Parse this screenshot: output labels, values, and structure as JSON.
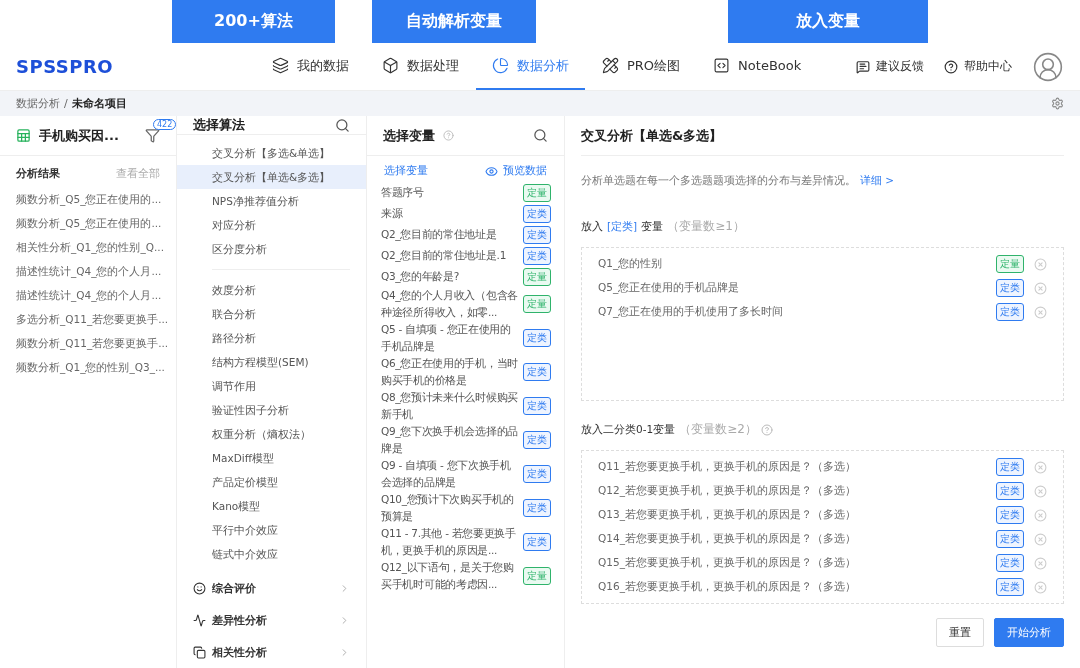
{
  "callouts": [
    "200+算法",
    "自动解析变量",
    "放入变量"
  ],
  "logo": "SPSSPRO",
  "nav": [
    {
      "label": "我的数据",
      "selected": false
    },
    {
      "label": "数据处理",
      "selected": false
    },
    {
      "label": "数据分析",
      "selected": true
    },
    {
      "label": "PRO绘图",
      "selected": false
    },
    {
      "label": "NoteBook",
      "selected": false
    }
  ],
  "nav_right": [
    "建议反馈",
    "帮助中心"
  ],
  "breadcrumb": {
    "items": [
      "数据分析",
      "未命名项目"
    ],
    "separator": "/"
  },
  "dataset": {
    "name": "手机购买因...",
    "count": "422"
  },
  "results": {
    "title": "分析结果",
    "view_all": "查看全部",
    "items": [
      "频数分析_Q5_您正在使用的...",
      "频数分析_Q5_您正在使用的...",
      "相关性分析_Q1_您的性别_Q...",
      "描述性统计_Q4_您的个人月...",
      "描述性统计_Q4_您的个人月...",
      "多选分析_Q11_若您要更换手...",
      "频数分析_Q11_若您要更换手...",
      "频数分析_Q1_您的性别_Q3_..."
    ]
  },
  "algorithms": {
    "title": "选择算法",
    "groups": [
      [
        {
          "label": "交叉分析【多选&单选】",
          "selected": false
        },
        {
          "label": "交叉分析【单选&多选】",
          "selected": true
        },
        {
          "label": "NPS净推荐值分析",
          "selected": false
        },
        {
          "label": "对应分析",
          "selected": false
        },
        {
          "label": "区分度分析",
          "selected": false
        }
      ],
      [
        {
          "label": "效度分析",
          "selected": false
        },
        {
          "label": "联合分析",
          "selected": false
        },
        {
          "label": "路径分析",
          "selected": false
        },
        {
          "label": "结构方程模型(SEM)",
          "selected": false
        },
        {
          "label": "调节作用",
          "selected": false
        },
        {
          "label": "验证性因子分析",
          "selected": false
        },
        {
          "label": "权重分析（熵权法）",
          "selected": false
        },
        {
          "label": "MaxDiff模型",
          "selected": false
        },
        {
          "label": "产品定价模型",
          "selected": false
        },
        {
          "label": "Kano模型",
          "selected": false
        },
        {
          "label": "平行中介效应",
          "selected": false
        },
        {
          "label": "链式中介效应",
          "selected": false
        }
      ]
    ],
    "categories": [
      "综合评价",
      "差异性分析",
      "相关性分析"
    ]
  },
  "variables": {
    "title": "选择变量",
    "subtitle": "选择变量",
    "preview": "预览数据",
    "items": [
      {
        "name": "答题序号",
        "tag": "定量",
        "kind": "quant"
      },
      {
        "name": "来源",
        "tag": "定类",
        "kind": "cat"
      },
      {
        "name": "Q2_您目前的常住地址是",
        "tag": "定类",
        "kind": "cat"
      },
      {
        "name": "Q2_您目前的常住地址是.1",
        "tag": "定类",
        "kind": "cat"
      },
      {
        "name": "Q3_您的年龄是?",
        "tag": "定量",
        "kind": "quant"
      },
      {
        "name": "Q4_您的个人月收入（包含各种途径所得收入，如零...",
        "tag": "定量",
        "kind": "quant"
      },
      {
        "name": "Q5 - 自填项 - 您正在使用的手机品牌是",
        "tag": "定类",
        "kind": "cat"
      },
      {
        "name": "Q6_您正在使用的手机，当时购买手机的价格是",
        "tag": "定类",
        "kind": "cat"
      },
      {
        "name": "Q8_您预计未来什么时候购买新手机",
        "tag": "定类",
        "kind": "cat"
      },
      {
        "name": "Q9_您下次换手机会选择的品牌是",
        "tag": "定类",
        "kind": "cat"
      },
      {
        "name": "Q9 - 自填项 - 您下次换手机会选择的品牌是",
        "tag": "定类",
        "kind": "cat"
      },
      {
        "name": "Q10_您预计下次购买手机的预算是",
        "tag": "定类",
        "kind": "cat"
      },
      {
        "name": "Q11 - 7.其他 - 若您要更换手机，更换手机的原因是...",
        "tag": "定类",
        "kind": "cat"
      },
      {
        "name": "Q12_以下语句，是关于您购买手机时可能的考虑因...",
        "tag": "定量",
        "kind": "quant"
      }
    ]
  },
  "panel": {
    "title": "交叉分析【单选&多选】",
    "description": "分析单选题在每一个多选题题项选择的分布与差异情况。",
    "detail_link": "详细 >",
    "sections": [
      {
        "label": [
          {
            "text": "放入",
            "kind": "plain"
          },
          {
            "text": "[定类]",
            "kind": "accent"
          },
          {
            "text": "变量",
            "kind": "plain"
          }
        ],
        "hint": "（变量数≥1）",
        "help": false,
        "items": [
          {
            "name": "Q1_您的性别",
            "tag": "定量",
            "kind": "quant"
          },
          {
            "name": "Q5_您正在使用的手机品牌是",
            "tag": "定类",
            "kind": "cat"
          },
          {
            "name": "Q7_您正在使用的手机使用了多长时间",
            "tag": "定类",
            "kind": "cat"
          }
        ]
      },
      {
        "label": [
          {
            "text": "放入二分类0-1变量",
            "kind": "plain"
          }
        ],
        "hint": "（变量数≥2）",
        "help": true,
        "items": [
          {
            "name": "Q11_若您要更换手机，更换手机的原因是？（多选）",
            "tag": "定类",
            "kind": "cat"
          },
          {
            "name": "Q12_若您要更换手机，更换手机的原因是？（多选）",
            "tag": "定类",
            "kind": "cat"
          },
          {
            "name": "Q13_若您要更换手机，更换手机的原因是？（多选）",
            "tag": "定类",
            "kind": "cat"
          },
          {
            "name": "Q14_若您要更换手机，更换手机的原因是？（多选）",
            "tag": "定类",
            "kind": "cat"
          },
          {
            "name": "Q15_若您要更换手机，更换手机的原因是？（多选）",
            "tag": "定类",
            "kind": "cat"
          },
          {
            "name": "Q16_若您要更换手机，更换手机的原因是？（多选）",
            "tag": "定类",
            "kind": "cat"
          }
        ]
      }
    ]
  },
  "buttons": {
    "reset": "重置",
    "start": "开始分析"
  }
}
